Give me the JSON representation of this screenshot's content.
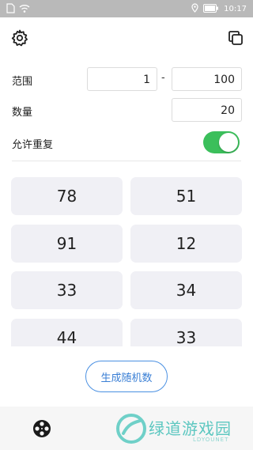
{
  "status_bar": {
    "time": "10:17",
    "icons": [
      "sim-icon",
      "wifi-icon",
      "location-icon",
      "battery-icon"
    ]
  },
  "toolbar": {
    "left_icon": "gear-icon",
    "right_icon": "copy-icon"
  },
  "settings": {
    "range_label": "范围",
    "range_min": "1",
    "range_separator": "-",
    "range_max": "100",
    "count_label": "数量",
    "count_value": "20",
    "allow_repeat_label": "允许重复",
    "allow_repeat_on": true
  },
  "results": [
    "78",
    "51",
    "91",
    "12",
    "33",
    "34",
    "44",
    "33"
  ],
  "generate_button": "生成随机数",
  "bottom_bar": {
    "tab_icon": "film-reel-icon"
  },
  "watermark": {
    "text": "绿道游戏园",
    "sub": "LDYOUNET"
  },
  "colors": {
    "status_bar": "#b9b9b9",
    "toggle_on": "#3bbf5b",
    "accent": "#4a90e2",
    "cell_bg": "#f0f0f5"
  }
}
